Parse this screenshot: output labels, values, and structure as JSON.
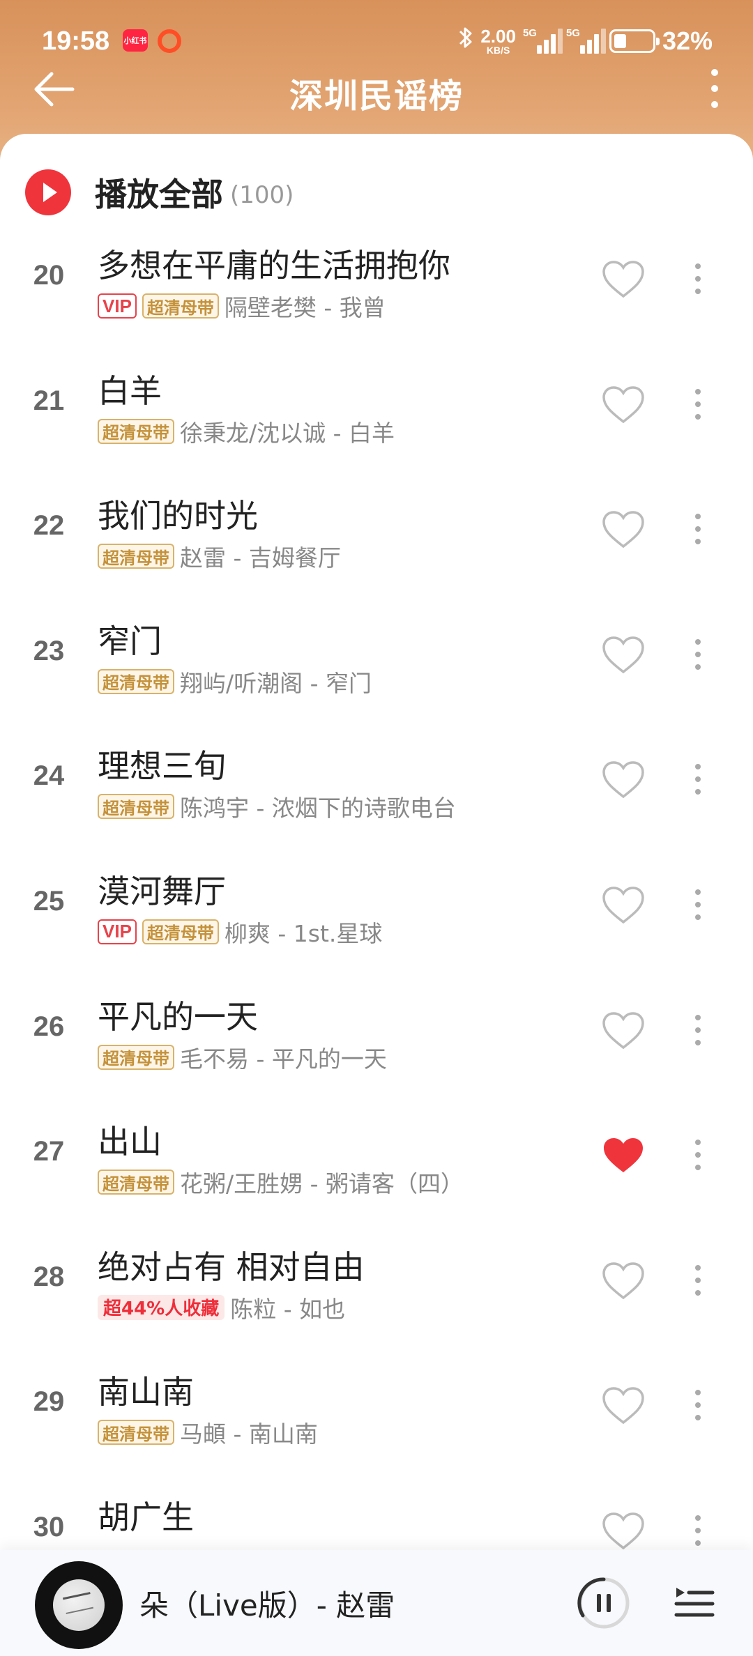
{
  "status": {
    "time": "19:58",
    "app_badge": "小红书",
    "net_speed_value": "2.00",
    "net_speed_unit": "KB/S",
    "signal_label_1": "5G",
    "signal_label_2": "5G",
    "battery_percent_text": "32%",
    "battery_level": 0.32
  },
  "nav": {
    "title": "深圳民谣榜",
    "back_icon": "arrow-left-icon",
    "more_icon": "more-vertical-icon"
  },
  "play_all": {
    "label": "播放全部",
    "count": "(100)"
  },
  "songs": [
    {
      "rank": "20",
      "title": "多想在平庸的生活拥抱你",
      "tags": [
        "VIP",
        "超清母带"
      ],
      "meta": "隔壁老樊 - 我曾",
      "liked": false
    },
    {
      "rank": "21",
      "title": "白羊",
      "tags": [
        "超清母带"
      ],
      "meta": "徐秉龙/沈以诚 - 白羊",
      "liked": false
    },
    {
      "rank": "22",
      "title": "我们的时光",
      "tags": [
        "超清母带"
      ],
      "meta": "赵雷 - 吉姆餐厅",
      "liked": false
    },
    {
      "rank": "23",
      "title": "窄门",
      "tags": [
        "超清母带"
      ],
      "meta": "翔屿/听潮阁 - 窄门",
      "liked": false
    },
    {
      "rank": "24",
      "title": "理想三旬",
      "tags": [
        "超清母带"
      ],
      "meta": "陈鸿宇 - 浓烟下的诗歌电台",
      "liked": false
    },
    {
      "rank": "25",
      "title": "漠河舞厅",
      "tags": [
        "VIP",
        "超清母带"
      ],
      "meta": "柳爽 - 1st.星球",
      "liked": false
    },
    {
      "rank": "26",
      "title": "平凡的一天",
      "tags": [
        "超清母带"
      ],
      "meta": "毛不易 - 平凡的一天",
      "liked": false
    },
    {
      "rank": "27",
      "title": "出山",
      "tags": [
        "超清母带"
      ],
      "meta": "花粥/王胜娚 - 粥请客（四）",
      "liked": true
    },
    {
      "rank": "28",
      "title": "绝对占有 相对自由",
      "tags": [
        "超44%人收藏"
      ],
      "meta": "陈粒 - 如也",
      "liked": false
    },
    {
      "rank": "29",
      "title": "南山南",
      "tags": [
        "超清母带"
      ],
      "meta": "马頔 - 南山南",
      "liked": false
    },
    {
      "rank": "30",
      "title": "胡广生",
      "tags": [],
      "meta": "",
      "liked": false
    }
  ],
  "mini_player": {
    "now_playing": "朵（Live版）- 赵雷",
    "pause_icon": "pause-circle-icon",
    "playlist_icon": "playlist-icon"
  },
  "colors": {
    "header_gradient_top": "#d8915a",
    "header_gradient_bottom": "#ecbd92",
    "accent_red": "#f0343c",
    "liked_heart": "#f0343c",
    "vip_tag": "#e8424a",
    "hq_tag": "#c4913a"
  }
}
